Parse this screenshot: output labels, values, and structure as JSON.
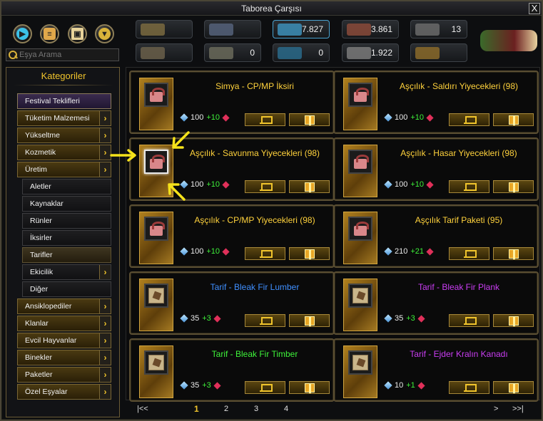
{
  "window": {
    "title": "Taborea Çarşısı",
    "close_label": "X"
  },
  "toolbar": {
    "search_placeholder": "Eşya Arama",
    "tool_icons": [
      "play-icon",
      "scroll-icon",
      "box-icon",
      "filter-icon"
    ]
  },
  "currencies": [
    {
      "icon": "map-icon",
      "value": ""
    },
    {
      "icon": "arrow-up-icon",
      "value": ""
    },
    {
      "icon": "diamond-icon",
      "value": "7.827"
    },
    {
      "icon": "ruby-icon",
      "value": "3.861"
    },
    {
      "icon": "medal-icon",
      "value": "13"
    },
    {
      "icon": "scroll-map-icon",
      "value": ""
    },
    {
      "icon": "coin-icon",
      "value": "0"
    },
    {
      "icon": "crystal-icon",
      "value": "0"
    },
    {
      "icon": "silver-coin-icon",
      "value": "1.922"
    },
    {
      "icon": "chain-icon",
      "value": ""
    }
  ],
  "sidebar": {
    "title": "Kategoriler",
    "items": [
      {
        "label": "Festival Teklifleri",
        "arrow": false,
        "sub": false,
        "active": true
      },
      {
        "label": "Tüketim Malzemesi",
        "arrow": true,
        "sub": false
      },
      {
        "label": "Yükseltme",
        "arrow": true,
        "sub": false
      },
      {
        "label": "Kozmetik",
        "arrow": true,
        "sub": false
      },
      {
        "label": "Üretim",
        "arrow": true,
        "sub": false
      },
      {
        "label": "Aletler",
        "arrow": false,
        "sub": true
      },
      {
        "label": "Kaynaklar",
        "arrow": false,
        "sub": true
      },
      {
        "label": "Rünler",
        "arrow": false,
        "sub": true
      },
      {
        "label": "İksirler",
        "arrow": false,
        "sub": true
      },
      {
        "label": "Tarifler",
        "arrow": false,
        "sub": true,
        "active": true
      },
      {
        "label": "Ekicilik",
        "arrow": true,
        "sub": true
      },
      {
        "label": "Diğer",
        "arrow": false,
        "sub": true
      },
      {
        "label": "Ansiklopediler",
        "arrow": true,
        "sub": false
      },
      {
        "label": "Klanlar",
        "arrow": true,
        "sub": false
      },
      {
        "label": "Evcil Hayvanlar",
        "arrow": true,
        "sub": false
      },
      {
        "label": "Binekler",
        "arrow": true,
        "sub": false
      },
      {
        "label": "Paketler",
        "arrow": true,
        "sub": false
      },
      {
        "label": "Özel Eşyalar",
        "arrow": true,
        "sub": false
      }
    ]
  },
  "items": [
    {
      "name": "Simya - CP/MP İksiri",
      "color": "yellow",
      "icon": "gift-box-icon",
      "price": "100",
      "bonus": "+10"
    },
    {
      "name": "Aşçılık - Saldırı Yiyecekleri (98)",
      "color": "yellow",
      "icon": "gift-box-icon",
      "price": "100",
      "bonus": "+10"
    },
    {
      "name": "Aşçılık - Savunma Yiyecekleri (98)",
      "color": "yellow",
      "icon": "gift-box-icon",
      "price": "100",
      "bonus": "+10",
      "selected": true
    },
    {
      "name": "Aşçılık - Hasar Yiyecekleri (98)",
      "color": "yellow",
      "icon": "gift-box-icon",
      "price": "100",
      "bonus": "+10"
    },
    {
      "name": "Aşçılık - CP/MP Yiyecekleri (98)",
      "color": "yellow",
      "icon": "gift-box-icon",
      "price": "100",
      "bonus": "+10"
    },
    {
      "name": "Aşçılık Tarif Paketi (95)",
      "color": "yellow",
      "icon": "gift-box-icon",
      "price": "210",
      "bonus": "+21"
    },
    {
      "name": "Tarif - Bleak Fir Lumber",
      "color": "blue",
      "icon": "recipe-icon",
      "price": "35",
      "bonus": "+3"
    },
    {
      "name": "Tarif - Bleak Fir Plank",
      "color": "purple",
      "icon": "recipe-icon",
      "price": "35",
      "bonus": "+3"
    },
    {
      "name": "Tarif - Bleak Fir Timber",
      "color": "green",
      "icon": "recipe-icon",
      "price": "35",
      "bonus": "+3"
    },
    {
      "name": "Tarif - Ejder Kralın Kanadı",
      "color": "purple",
      "icon": "recipe-icon",
      "price": "10",
      "bonus": "+1"
    }
  ],
  "pager": {
    "first": "|<<",
    "pages": [
      "1",
      "2",
      "3",
      "4"
    ],
    "current": "1",
    "next": ">",
    "last": ">>|"
  }
}
